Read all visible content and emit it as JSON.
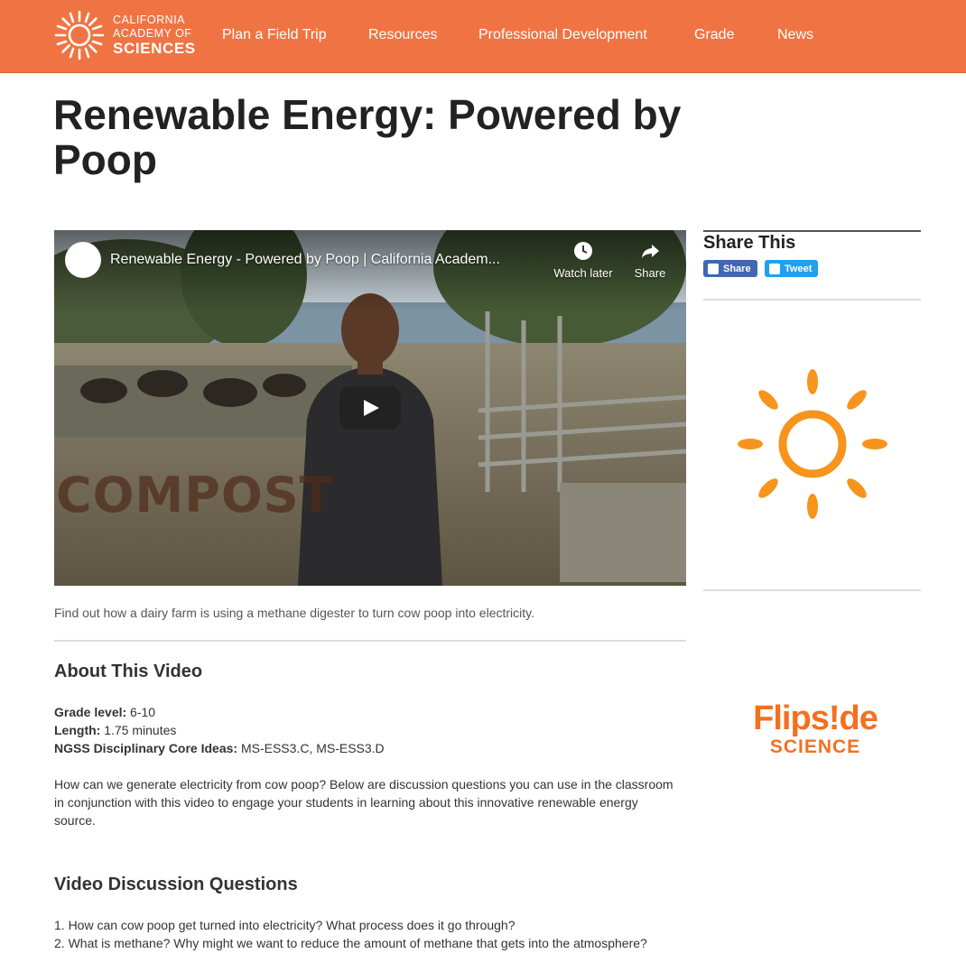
{
  "header": {
    "logo": {
      "line1": "CALIFORNIA",
      "line2": "ACADEMY OF",
      "line3": "SCIENCES",
      "icon": "sunburst-logo-icon"
    },
    "nav": [
      {
        "label": "Plan a Field Trip"
      },
      {
        "label": "Resources"
      },
      {
        "label": "Professional Development"
      },
      {
        "label": "Grade"
      },
      {
        "label": "News"
      }
    ]
  },
  "page": {
    "title": "Renewable Energy: Powered by Poop"
  },
  "video": {
    "title": "Renewable Energy - Powered by Poop | California Academ...",
    "watch_later": "Watch later",
    "share": "Share",
    "overlay_text": "COMPOST",
    "caption": "Find out how a dairy farm is using a methane digester to turn cow poop into electricity."
  },
  "about": {
    "heading": "About This Video",
    "grade_label": "Grade level:",
    "grade_value": "6-10",
    "length_label": "Length:",
    "length_value": "1.75 minutes",
    "ngss_label": "NGSS Disciplinary Core Ideas:",
    "ngss_value": "MS-ESS3.C, MS-ESS3.D",
    "description": "How can we generate electricity from cow poop? Below are discussion questions you can use in the classroom in conjunction with this video to engage your students in learning about this innovative renewable energy source."
  },
  "questions": {
    "heading": "Video Discussion Questions",
    "items": [
      "1. How can cow poop get turned into electricity?  What process does it go through?",
      "2. What is methane?  Why might we want to reduce the amount of methane that gets into the atmosphere?"
    ]
  },
  "sidebar": {
    "share_title": "Share This",
    "facebook_label": "Share",
    "twitter_label": "Tweet",
    "flipside_line1": "Flips!de",
    "flipside_line2": "SCIENCE"
  },
  "colors": {
    "brand_orange": "#f07443",
    "sun_orange": "#f7941d",
    "flipside_orange": "#f37021"
  }
}
